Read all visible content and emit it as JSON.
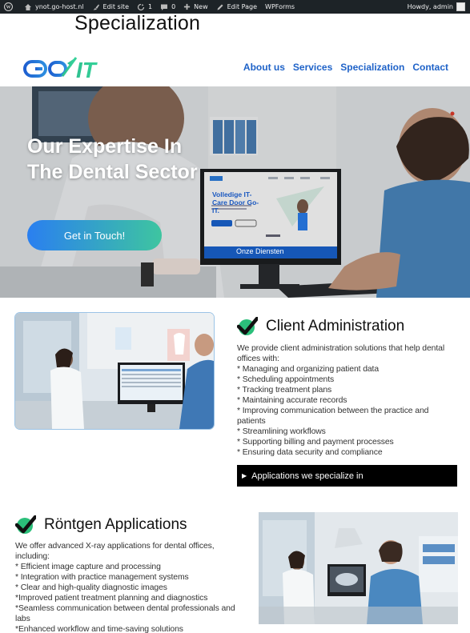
{
  "adminbar": {
    "site": "ynot.go-host.nl",
    "edit_site": "Edit site",
    "updates": "1",
    "comments": "0",
    "new": "New",
    "edit_page": "Edit Page",
    "wpforms": "WPForms",
    "howdy": "Howdy, admin"
  },
  "page_title": "Specialization",
  "logo": {
    "text": "Go-IT"
  },
  "nav": [
    "About us",
    "Services",
    "Specialization",
    "Contact"
  ],
  "hero": {
    "title": "Our Expertise In The Dental Sector",
    "button": "Get in Touch!",
    "monitor_heading": "Volledige IT-Care Door Go-IT.",
    "monitor_footer": "Onze Diensten"
  },
  "section1": {
    "title": "Client Administration",
    "intro": "We provide client administration solutions that help dental offices with:",
    "items": [
      "* Managing and organizing patient data",
      "* Scheduling appointments",
      "* Tracking treatment plans",
      "* Maintaining accurate records",
      "* Improving communication between the practice and patients",
      "* Streamlining workflows",
      "* Supporting billing and payment processes",
      "* Ensuring data security and compliance"
    ],
    "accordion": "Applications we specialize in"
  },
  "section2": {
    "title": "Röntgen Applications",
    "intro": "We offer advanced X-ray applications for dental offices, including:",
    "items": [
      "* Efficient image capture and processing",
      "* Integration with practice management systems",
      "* Clear and high-quality diagnostic images",
      "*Improved patient treatment planning and diagnostics",
      "*Seamless communication between dental professionals and labs",
      "*Enhanced workflow and time-saving solutions"
    ]
  },
  "colors": {
    "nav": "#1e62c8",
    "accent_start": "#2a7ff0",
    "accent_end": "#3ec5a0",
    "check": "#111111",
    "check_bg": "#2bbf7a"
  }
}
